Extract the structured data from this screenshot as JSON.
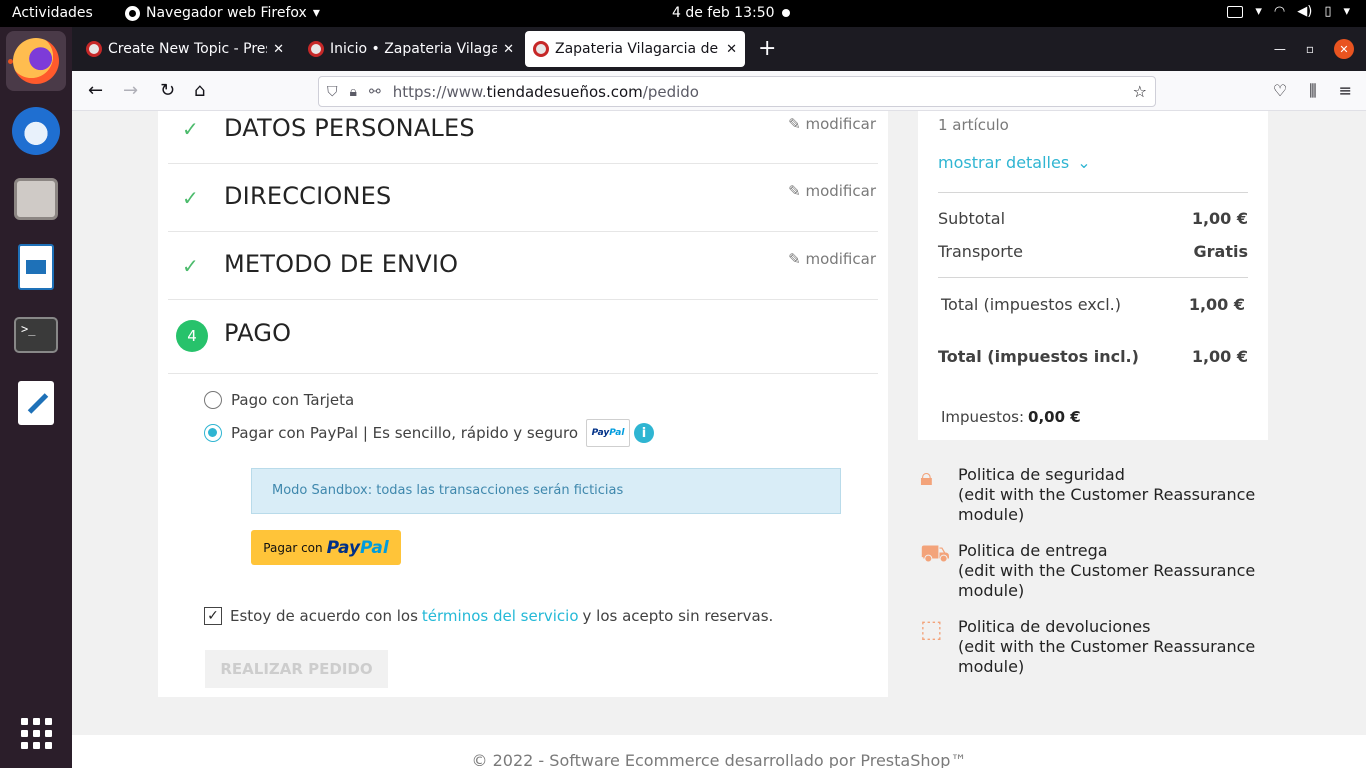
{
  "system": {
    "activities": "Actividades",
    "app_name": "Navegador web Firefox",
    "clock": "4 de feb  13:50"
  },
  "browser": {
    "tabs": [
      {
        "title": "Create New Topic - Presta",
        "active": false
      },
      {
        "title": "Inicio • Zapateria Vilagarc",
        "active": false
      },
      {
        "title": "Zapateria Vilagarcia de A",
        "active": true
      }
    ],
    "url_prefix": "https://www.",
    "url_domain": "tiendadesueños.com",
    "url_path": "/pedido"
  },
  "checkout": {
    "modify_label": "modificar",
    "steps": [
      {
        "title": "DATOS PERSONALES",
        "status": "done"
      },
      {
        "title": "DIRECCIONES",
        "status": "done"
      },
      {
        "title": "METODO DE ENVIO",
        "status": "done"
      },
      {
        "title": "PAGO",
        "status": "current",
        "number": "4"
      }
    ],
    "payment_options": [
      {
        "label": "Pago con Tarjeta",
        "selected": false
      },
      {
        "label": "Pagar con PayPal | Es sencillo, rápido y seguro",
        "selected": true
      }
    ],
    "paypal_logo": "PayPal",
    "sandbox_notice": "Modo Sandbox: todas las transacciones serán ficticias",
    "paypal_button_prefix": "Pagar con",
    "paypal_button_brand": "PayPal",
    "terms_before": "Estoy de acuerdo con los",
    "terms_link": "términos del servicio",
    "terms_after": "y los acepto sin reservas.",
    "terms_checked": true,
    "order_button": "REALIZAR PEDIDO"
  },
  "summary": {
    "items_count": "1 artículo",
    "show_details": "mostrar detalles",
    "subtotal_label": "Subtotal",
    "subtotal_value": "1,00 €",
    "shipping_label": "Transporte",
    "shipping_value": "Gratis",
    "total_excl_label": "Total (impuestos excl.)",
    "total_excl_value": "1,00 €",
    "total_incl_label": "Total (impuestos incl.)",
    "total_incl_value": "1,00 €",
    "taxes_label": "Impuestos:",
    "taxes_value": "0,00 €"
  },
  "reassurance": [
    {
      "title": "Politica de seguridad",
      "text": "(edit with the Customer Reassurance module)",
      "icon": "lock-icon"
    },
    {
      "title": "Politica de entrega",
      "text": "(edit with the Customer Reassurance module)",
      "icon": "truck-icon"
    },
    {
      "title": "Politica de devoluciones",
      "text": "(edit with the Customer Reassurance module)",
      "icon": "return-box-icon"
    }
  ],
  "footer": "© 2022 - Software Ecommerce desarrollado por PrestaShop™",
  "colors": {
    "accent": "#2fb5d2",
    "success": "#27c26b",
    "paypal_yellow": "#ffc439"
  }
}
